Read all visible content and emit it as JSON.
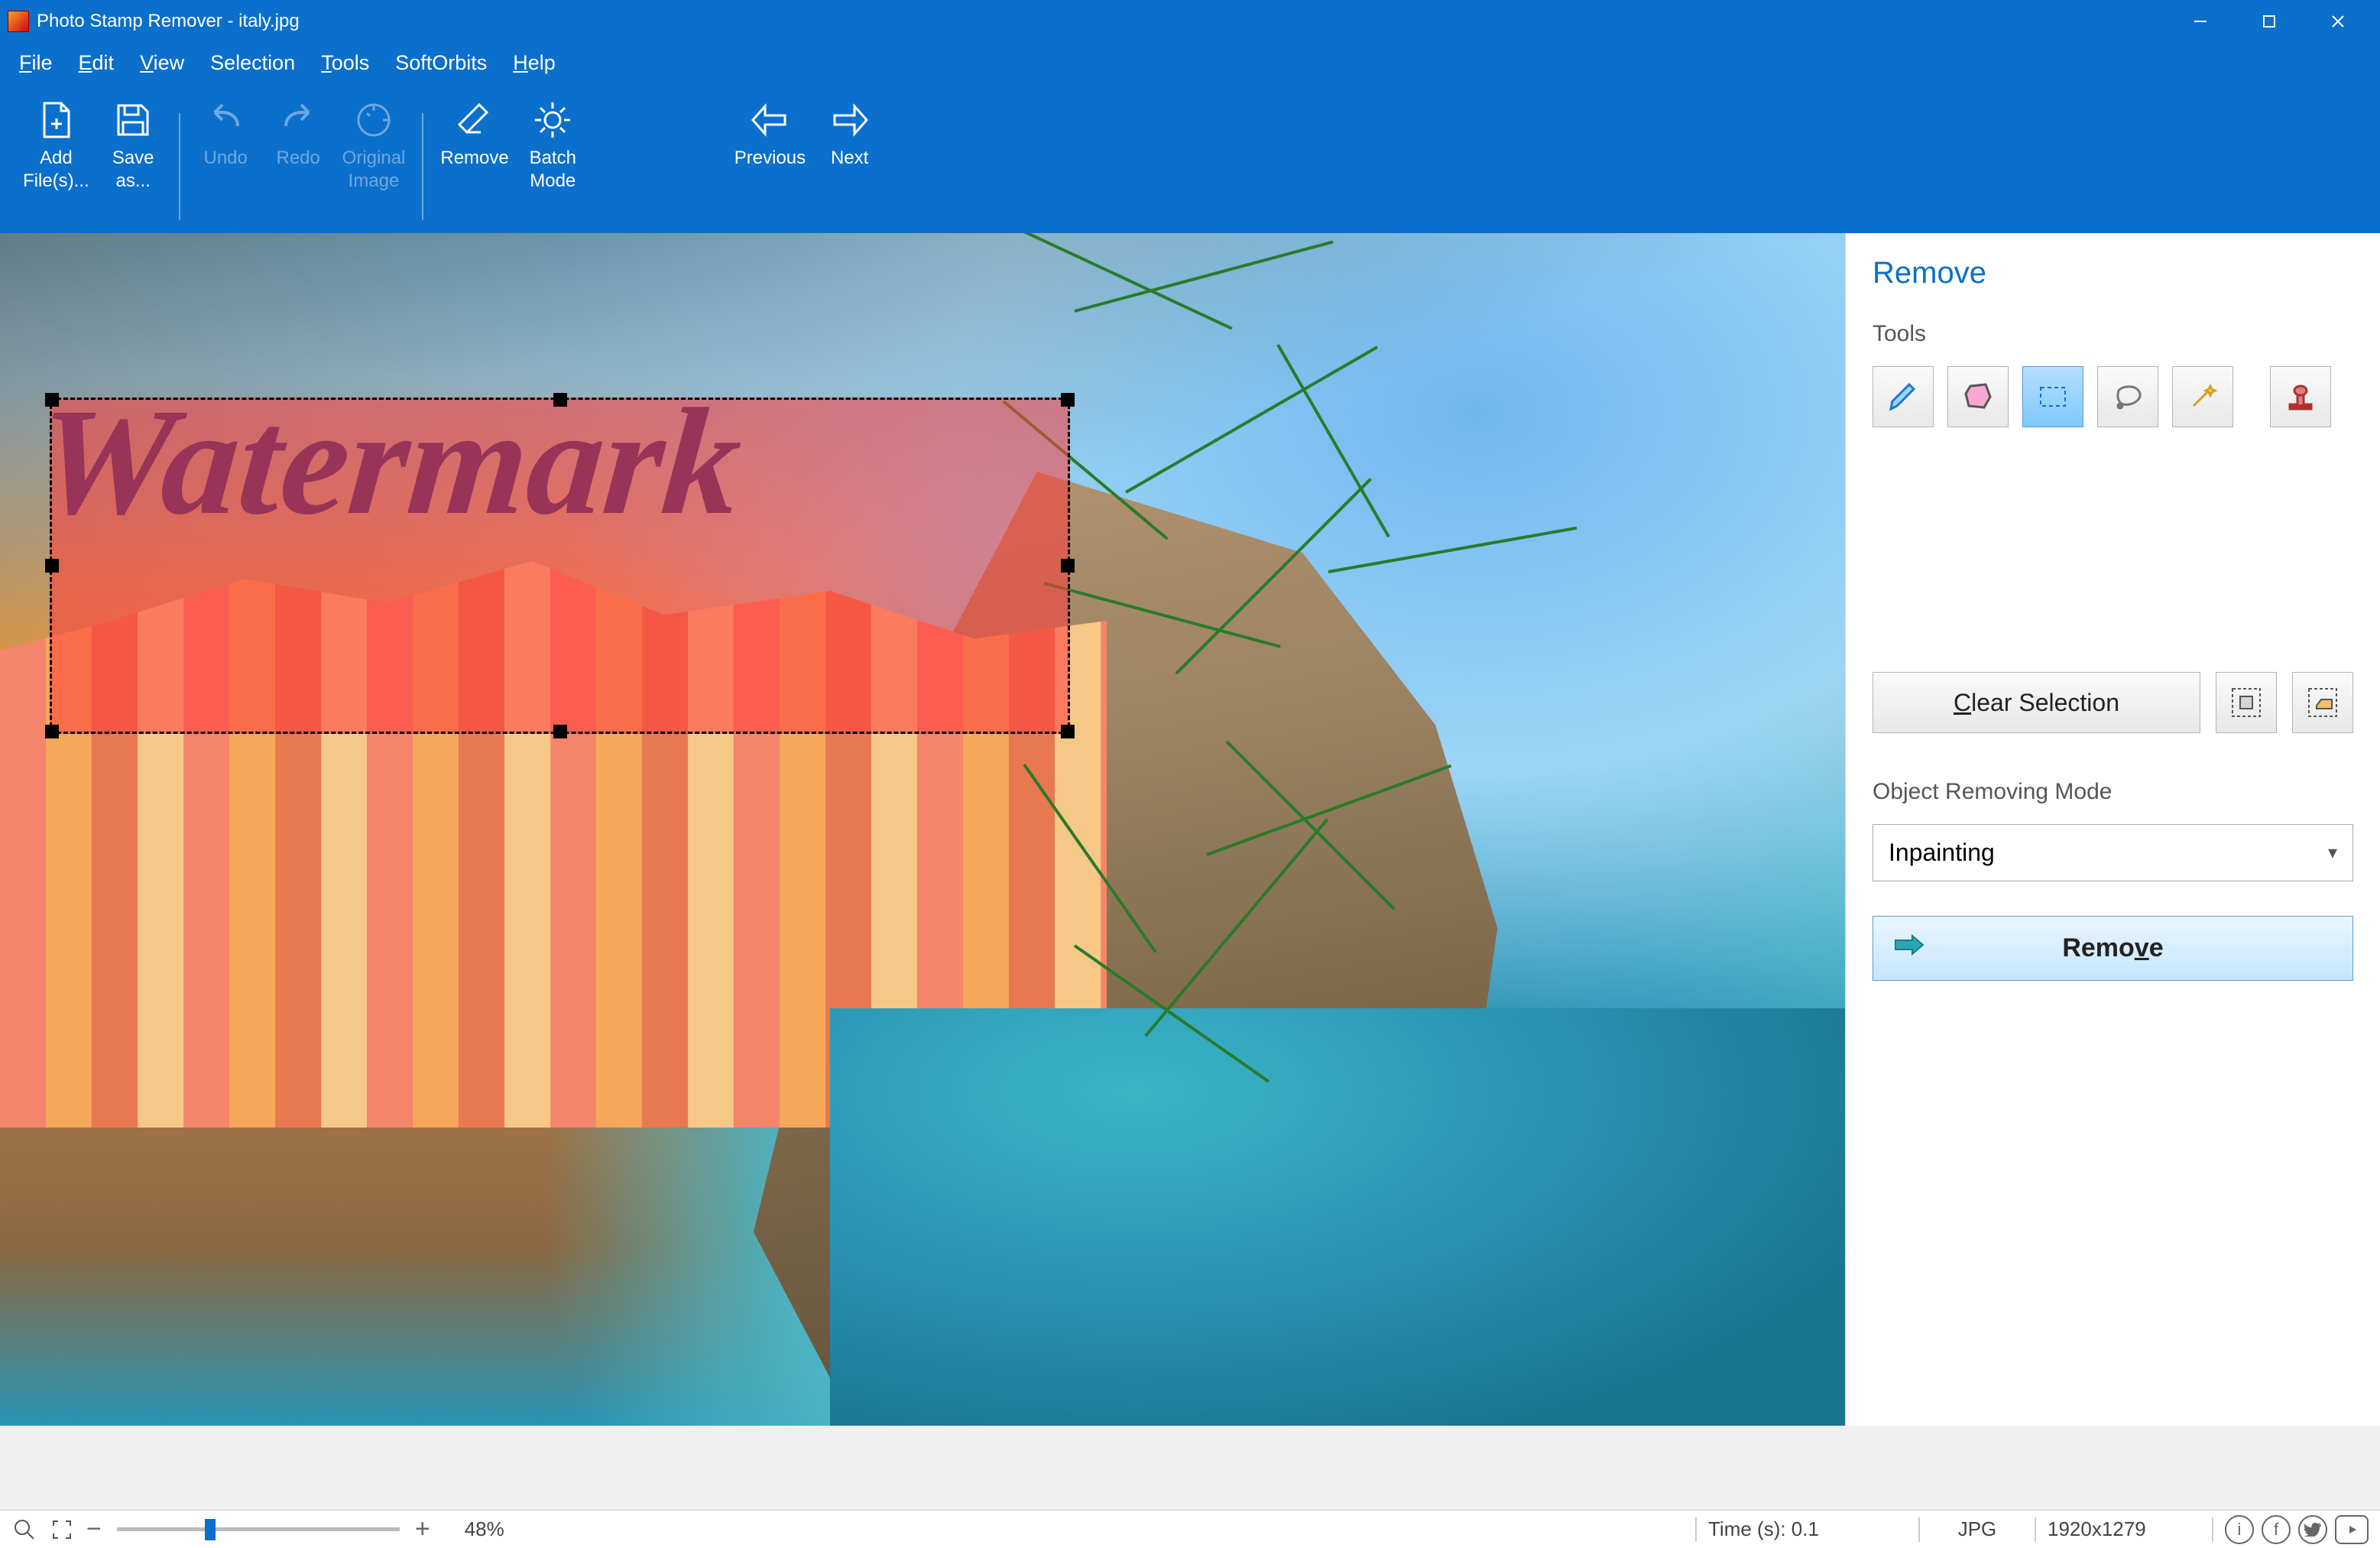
{
  "titlebar": {
    "title": "Photo Stamp Remover - italy.jpg"
  },
  "menu": {
    "file": "File",
    "edit": "Edit",
    "view": "View",
    "selection": "Selection",
    "tools": "Tools",
    "softorbits": "SoftOrbits",
    "help": "Help"
  },
  "toolbar": {
    "add_files": "Add\nFile(s)...",
    "save_as": "Save\nas...",
    "undo": "Undo",
    "redo": "Redo",
    "original": "Original\nImage",
    "remove": "Remove",
    "batch_mode": "Batch\nMode",
    "previous": "Previous",
    "next": "Next"
  },
  "canvas": {
    "watermark_text": "Watermark"
  },
  "panel": {
    "title": "Remove",
    "tools_label": "Tools",
    "clear_selection": "Clear Selection",
    "mode_label": "Object Removing Mode",
    "mode_value": "Inpainting",
    "remove_button": "Remove"
  },
  "status": {
    "zoom_percent": "48%",
    "time": "Time (s): 0.1",
    "format": "JPG",
    "dimensions": "1920x1279"
  }
}
